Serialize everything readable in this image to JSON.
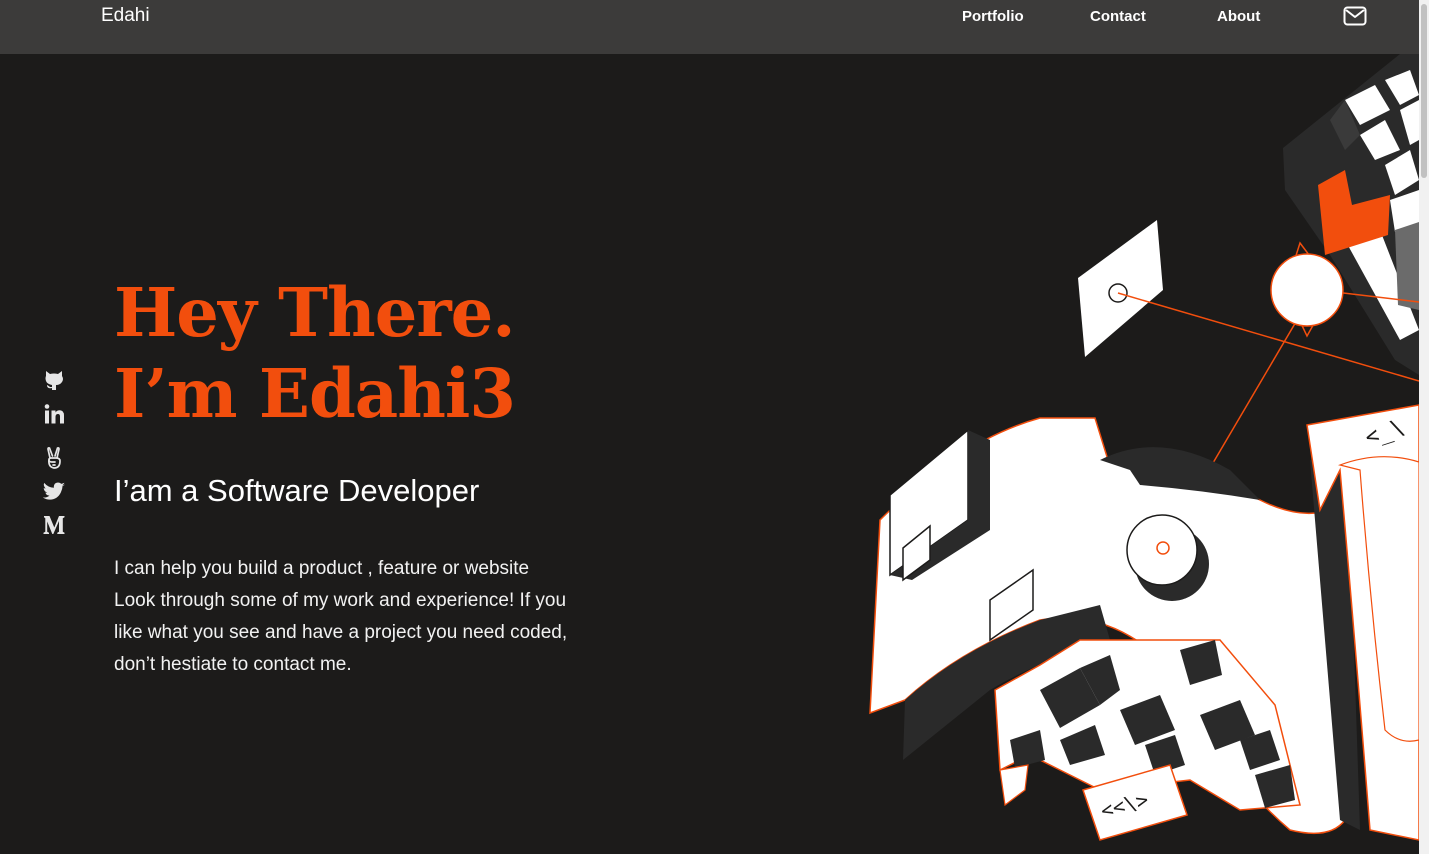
{
  "nav": {
    "brand": "Edahi",
    "links": [
      {
        "label": "Portfolio"
      },
      {
        "label": "Contact"
      },
      {
        "label": "About"
      }
    ],
    "mail_icon": "mail-icon"
  },
  "social": [
    {
      "icon": "github-icon"
    },
    {
      "icon": "linkedin-icon"
    },
    {
      "icon": "angellist-icon"
    },
    {
      "icon": "twitter-icon"
    },
    {
      "icon": "medium-icon"
    }
  ],
  "hero": {
    "line1": "Hey There.",
    "line2": "I’m Edahi3",
    "subtitle": "I’am a Software Developer",
    "description": [
      "I can help you build a product , feature or website",
      "Look through some of my work and experience! If you",
      "like what you see and have a project you need coded,",
      "don’t hestiate to contact me."
    ]
  },
  "illustration": {
    "code_tag_top": "<_\\",
    "code_tag_bottom": "<<\\>"
  },
  "colors": {
    "accent": "#f24e0d",
    "background": "#1c1b1a",
    "nav_background": "#3c3b3a",
    "text": "#ffffff"
  }
}
